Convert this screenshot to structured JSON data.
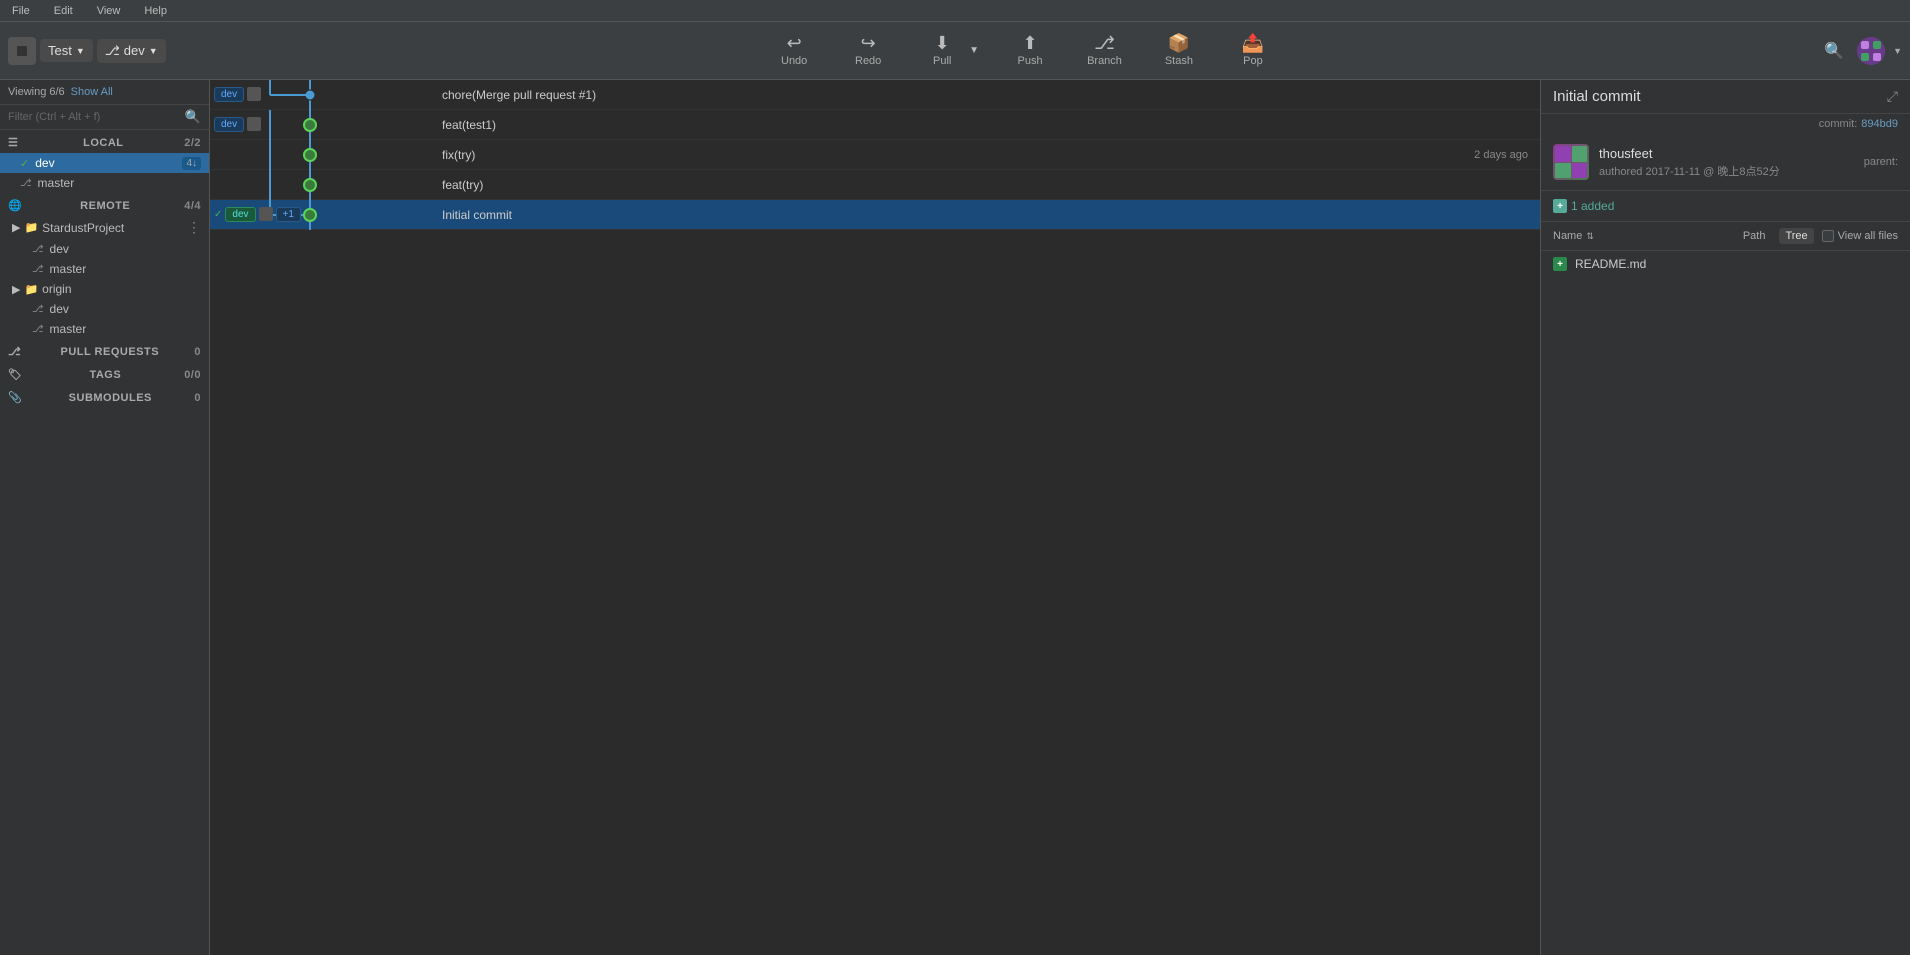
{
  "menubar": {
    "items": [
      "File",
      "Edit",
      "View",
      "Help"
    ]
  },
  "toolbar": {
    "repo_name": "Test",
    "branch_name": "dev",
    "buttons": [
      {
        "id": "undo",
        "label": "Undo",
        "icon": "↩"
      },
      {
        "id": "redo",
        "label": "Redo",
        "icon": "↪"
      },
      {
        "id": "pull",
        "label": "Pull",
        "icon": "⬇"
      },
      {
        "id": "push",
        "label": "Push",
        "icon": "⬆"
      },
      {
        "id": "branch",
        "label": "Branch",
        "icon": "⎇"
      },
      {
        "id": "stash",
        "label": "Stash",
        "icon": "📦"
      },
      {
        "id": "pop",
        "label": "Pop",
        "icon": "📤"
      }
    ]
  },
  "sidebar": {
    "viewing_label": "Viewing 6/6",
    "show_all": "Show All",
    "filter_placeholder": "Filter (Ctrl + Alt + f)",
    "local_section": "LOCAL",
    "local_count": "2/2",
    "local_branches": [
      {
        "name": "dev",
        "active": true,
        "badge": "4↓"
      },
      {
        "name": "master",
        "active": false
      }
    ],
    "remote_section": "REMOTE",
    "remote_count": "4/4",
    "remote_groups": [
      {
        "name": "StardustProject",
        "branches": [
          "dev",
          "master"
        ]
      },
      {
        "name": "origin",
        "branches": [
          "dev",
          "master"
        ]
      }
    ],
    "pull_requests_section": "PULL REQUESTS",
    "pull_requests_count": "0",
    "tags_section": "TAGS",
    "tags_count": "0/0",
    "submodules_section": "SUBMODULES",
    "submodules_count": "0"
  },
  "commits": [
    {
      "id": 1,
      "message": "chore(Merge pull request #1)",
      "time": "",
      "branches": [
        "dev"
      ],
      "selected": false,
      "has_avatar": false
    },
    {
      "id": 2,
      "message": "feat(test1)",
      "time": "",
      "branches": [
        "dev"
      ],
      "selected": false,
      "has_avatar": true
    },
    {
      "id": 3,
      "message": "fix(try)",
      "time": "2 days ago",
      "branches": [],
      "selected": false,
      "has_avatar": true
    },
    {
      "id": 4,
      "message": "feat(try)",
      "time": "",
      "branches": [],
      "selected": false,
      "has_avatar": true
    },
    {
      "id": 5,
      "message": "Initial commit",
      "time": "",
      "branches": [
        "dev",
        "+1"
      ],
      "selected": true,
      "has_avatar": true
    }
  ],
  "detail": {
    "commit_title": "Initial commit",
    "commit_label": "commit:",
    "commit_hash": "894bd9",
    "parent_label": "parent:",
    "author_name": "thousfeet",
    "author_date": "authored  2017-11-11 @ 晚上8点52分",
    "stats_added": "1 added",
    "files_name_col": "Name",
    "files_path_col": "Path",
    "files_tree_col": "Tree",
    "view_all_files": "View all files",
    "files": [
      {
        "name": "README.md",
        "status": "added"
      }
    ]
  }
}
